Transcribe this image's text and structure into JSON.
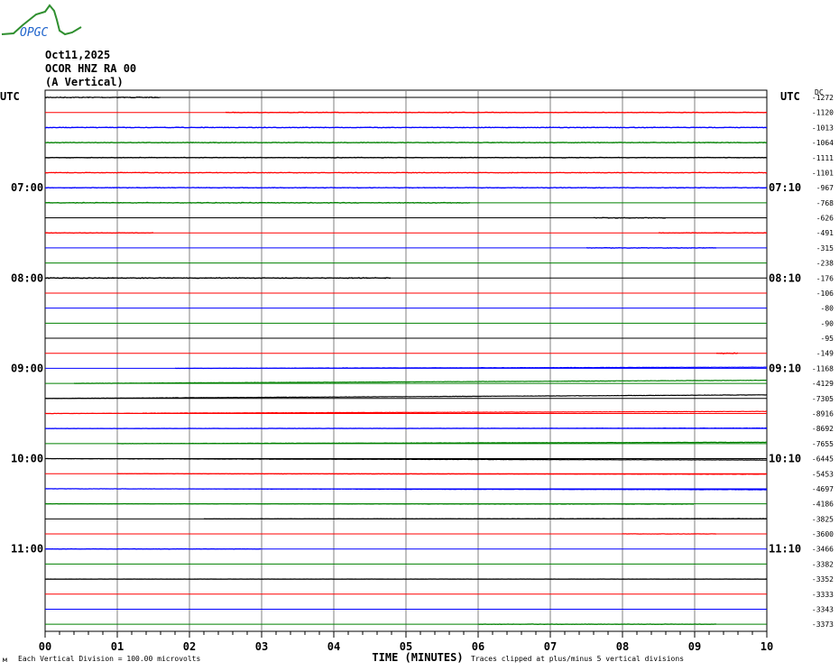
{
  "logo": {
    "text": "OPGC"
  },
  "header": {
    "date": "Oct11,2025",
    "station": "OCOR HNZ RA 00",
    "component": "(A Vertical)"
  },
  "colors": {
    "cycle": [
      "#000000",
      "#ff0000",
      "#0000ff",
      "#008000"
    ],
    "grid": "#808080"
  },
  "chart_data": {
    "type": "line",
    "title": "OCOR HNZ RA 00 helicorder",
    "xlabel": "TIME (MINUTES)",
    "xlim": [
      0,
      10
    ],
    "x_ticks": [
      "00",
      "01",
      "02",
      "03",
      "04",
      "05",
      "06",
      "07",
      "08",
      "09",
      "10"
    ],
    "left_header": "UTC",
    "right_header": "UTC",
    "dc_header": "DC",
    "left_labels": [
      {
        "row": 6,
        "text": "07:00"
      },
      {
        "row": 12,
        "text": "08:00"
      },
      {
        "row": 18,
        "text": "09:00"
      },
      {
        "row": 24,
        "text": "10:00"
      },
      {
        "row": 30,
        "text": "11:00"
      }
    ],
    "right_labels": [
      {
        "row": 6,
        "text": "07:10"
      },
      {
        "row": 12,
        "text": "08:10"
      },
      {
        "row": 18,
        "text": "09:10"
      },
      {
        "row": 24,
        "text": "10:10"
      },
      {
        "row": 30,
        "text": "11:10"
      }
    ],
    "dc_offsets": [
      "-1272",
      "-1120",
      "-1013",
      "-1064",
      "-1111",
      "-1101",
      "-967",
      "-768",
      "-626",
      "-491",
      "-315",
      "-238",
      "-176",
      "-106",
      "-80",
      "-90",
      "-95",
      "-149",
      "-1168",
      "-4129",
      "-7305",
      "-8916",
      "-8692",
      "-7655",
      "-6445",
      "-5453",
      "-4697",
      "-4186",
      "-3825",
      "-3600",
      "-3466",
      "-3382",
      "-3352",
      "-3333",
      "-3343",
      "-3373"
    ],
    "traces_minutes_per_row": 10,
    "traces": [
      {
        "row": 0,
        "start": 0,
        "end": 1.6,
        "noise": 0.15,
        "drift": 0
      },
      {
        "row": 1,
        "start": 2.5,
        "end": 10,
        "noise": 0.1,
        "drift": 0
      },
      {
        "row": 2,
        "start": 0,
        "end": 10,
        "noise": 0.12,
        "drift": 0
      },
      {
        "row": 3,
        "start": 0,
        "end": 10,
        "noise": 0.12,
        "drift": 0
      },
      {
        "row": 4,
        "start": 0,
        "end": 10,
        "noise": 0.1,
        "drift": 0
      },
      {
        "row": 5,
        "start": 0,
        "end": 10,
        "noise": 0.1,
        "drift": 0
      },
      {
        "row": 6,
        "start": 0,
        "end": 10,
        "noise": 0.12,
        "drift": 0
      },
      {
        "row": 7,
        "start": 0,
        "end": 5.9,
        "noise": 0.12,
        "drift": 0
      },
      {
        "row": 8,
        "start": 7.6,
        "end": 8.6,
        "noise": 0.12,
        "drift": 0
      },
      {
        "row": 9,
        "start": 0,
        "end": 1.5,
        "noise": 0.1,
        "drift": 0
      },
      {
        "row": 9,
        "start": 8.5,
        "end": 10,
        "noise": 0.1,
        "drift": 0
      },
      {
        "row": 10,
        "start": 7.5,
        "end": 9.3,
        "noise": 0.1,
        "drift": 0
      },
      {
        "row": 12,
        "start": 0,
        "end": 4.8,
        "noise": 0.15,
        "drift": 0
      },
      {
        "row": 17,
        "start": 9.3,
        "end": 9.6,
        "noise": 0.2,
        "drift": 0
      },
      {
        "row": 18,
        "start": 1.8,
        "end": 10,
        "noise": 0.05,
        "drift": 0.45
      },
      {
        "row": 19,
        "start": 0.4,
        "end": 10,
        "noise": 0.05,
        "drift": 1.1
      },
      {
        "row": 20,
        "start": 0,
        "end": 10,
        "noise": 0.05,
        "drift": 1.2
      },
      {
        "row": 21,
        "start": 0,
        "end": 10,
        "noise": 0.05,
        "drift": 0.7
      },
      {
        "row": 22,
        "start": 0,
        "end": 10,
        "noise": 0.05,
        "drift": 0.15
      },
      {
        "row": 23,
        "start": 1,
        "end": 10,
        "noise": 0.05,
        "drift": 0.5
      },
      {
        "row": 24,
        "start": 0,
        "end": 10,
        "noise": 0.05,
        "drift": -0.45
      },
      {
        "row": 25,
        "start": 1,
        "end": 10,
        "noise": 0.05,
        "drift": -0.2
      },
      {
        "row": 26,
        "start": 0,
        "end": 10,
        "noise": 0.05,
        "drift": -0.3
      },
      {
        "row": 27,
        "start": 0,
        "end": 9,
        "noise": 0.05,
        "drift": -0.1
      },
      {
        "row": 28,
        "start": 2.2,
        "end": 10,
        "noise": 0.05,
        "drift": 0.1
      },
      {
        "row": 29,
        "start": 8,
        "end": 9.3,
        "noise": 0.05,
        "drift": 0
      },
      {
        "row": 30,
        "start": 0,
        "end": 3,
        "noise": 0.08,
        "drift": 0
      },
      {
        "row": 32,
        "start": 0,
        "end": 10,
        "noise": 0.03,
        "drift": 0
      },
      {
        "row": 35,
        "start": 6,
        "end": 9.3,
        "noise": 0.08,
        "drift": 0
      }
    ],
    "footnote_left": "Each Vertical Division =  100.00 microvolts",
    "footnote_right": "Traces clipped at plus/minus 5 vertical divisions",
    "corner_mark": "м"
  }
}
